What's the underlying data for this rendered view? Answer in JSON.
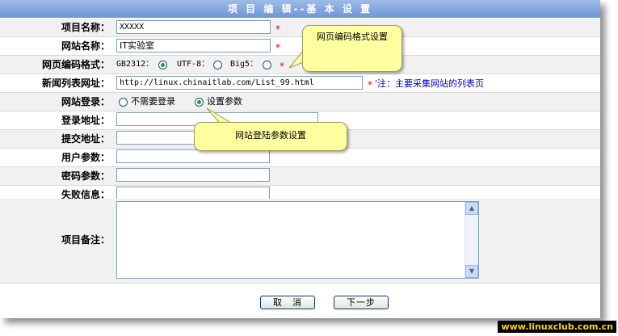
{
  "window": {
    "title": "项 目 编 辑--基 本 设 置"
  },
  "fields": {
    "project_name": {
      "label": "项目名称：",
      "value": "XXXXX"
    },
    "site_name": {
      "label": "网站名称：",
      "value": "IT实验室"
    },
    "encoding": {
      "label": "网页编码格式：",
      "options": [
        "GB2312：",
        "UTF-8：",
        "Big5："
      ],
      "selected": "GB2312"
    },
    "list_url": {
      "label": "新闻列表网址：",
      "value": "http://linux.chinaitlab.com/List_99.html",
      "note": "'注：主要采集网站的列表页"
    },
    "site_login": {
      "label": "网站登录：",
      "options": [
        "不需要登录",
        "设置参数"
      ],
      "selected": "设置参数"
    },
    "login_url": {
      "label": "登录地址：",
      "value": ""
    },
    "submit_url": {
      "label": "提交地址：",
      "value": ""
    },
    "user_param": {
      "label": "用户参数：",
      "value": ""
    },
    "password_param": {
      "label": "密码参数：",
      "value": ""
    },
    "failure_info": {
      "label": "失败信息：",
      "value": ""
    },
    "remarks": {
      "label": "项目备注：",
      "value": ""
    }
  },
  "required_mark": "*",
  "callouts": {
    "encoding": "网页编码格式设置",
    "login": "网站登陆参数设置"
  },
  "buttons": {
    "cancel": "取　消",
    "next": "下一步"
  },
  "watermark": "www.linuxclub.com.cn",
  "colors": {
    "title_bar": "#7a9fdc",
    "required": "#e00000",
    "note": "#0000cc",
    "callout": "#ffffa0"
  }
}
